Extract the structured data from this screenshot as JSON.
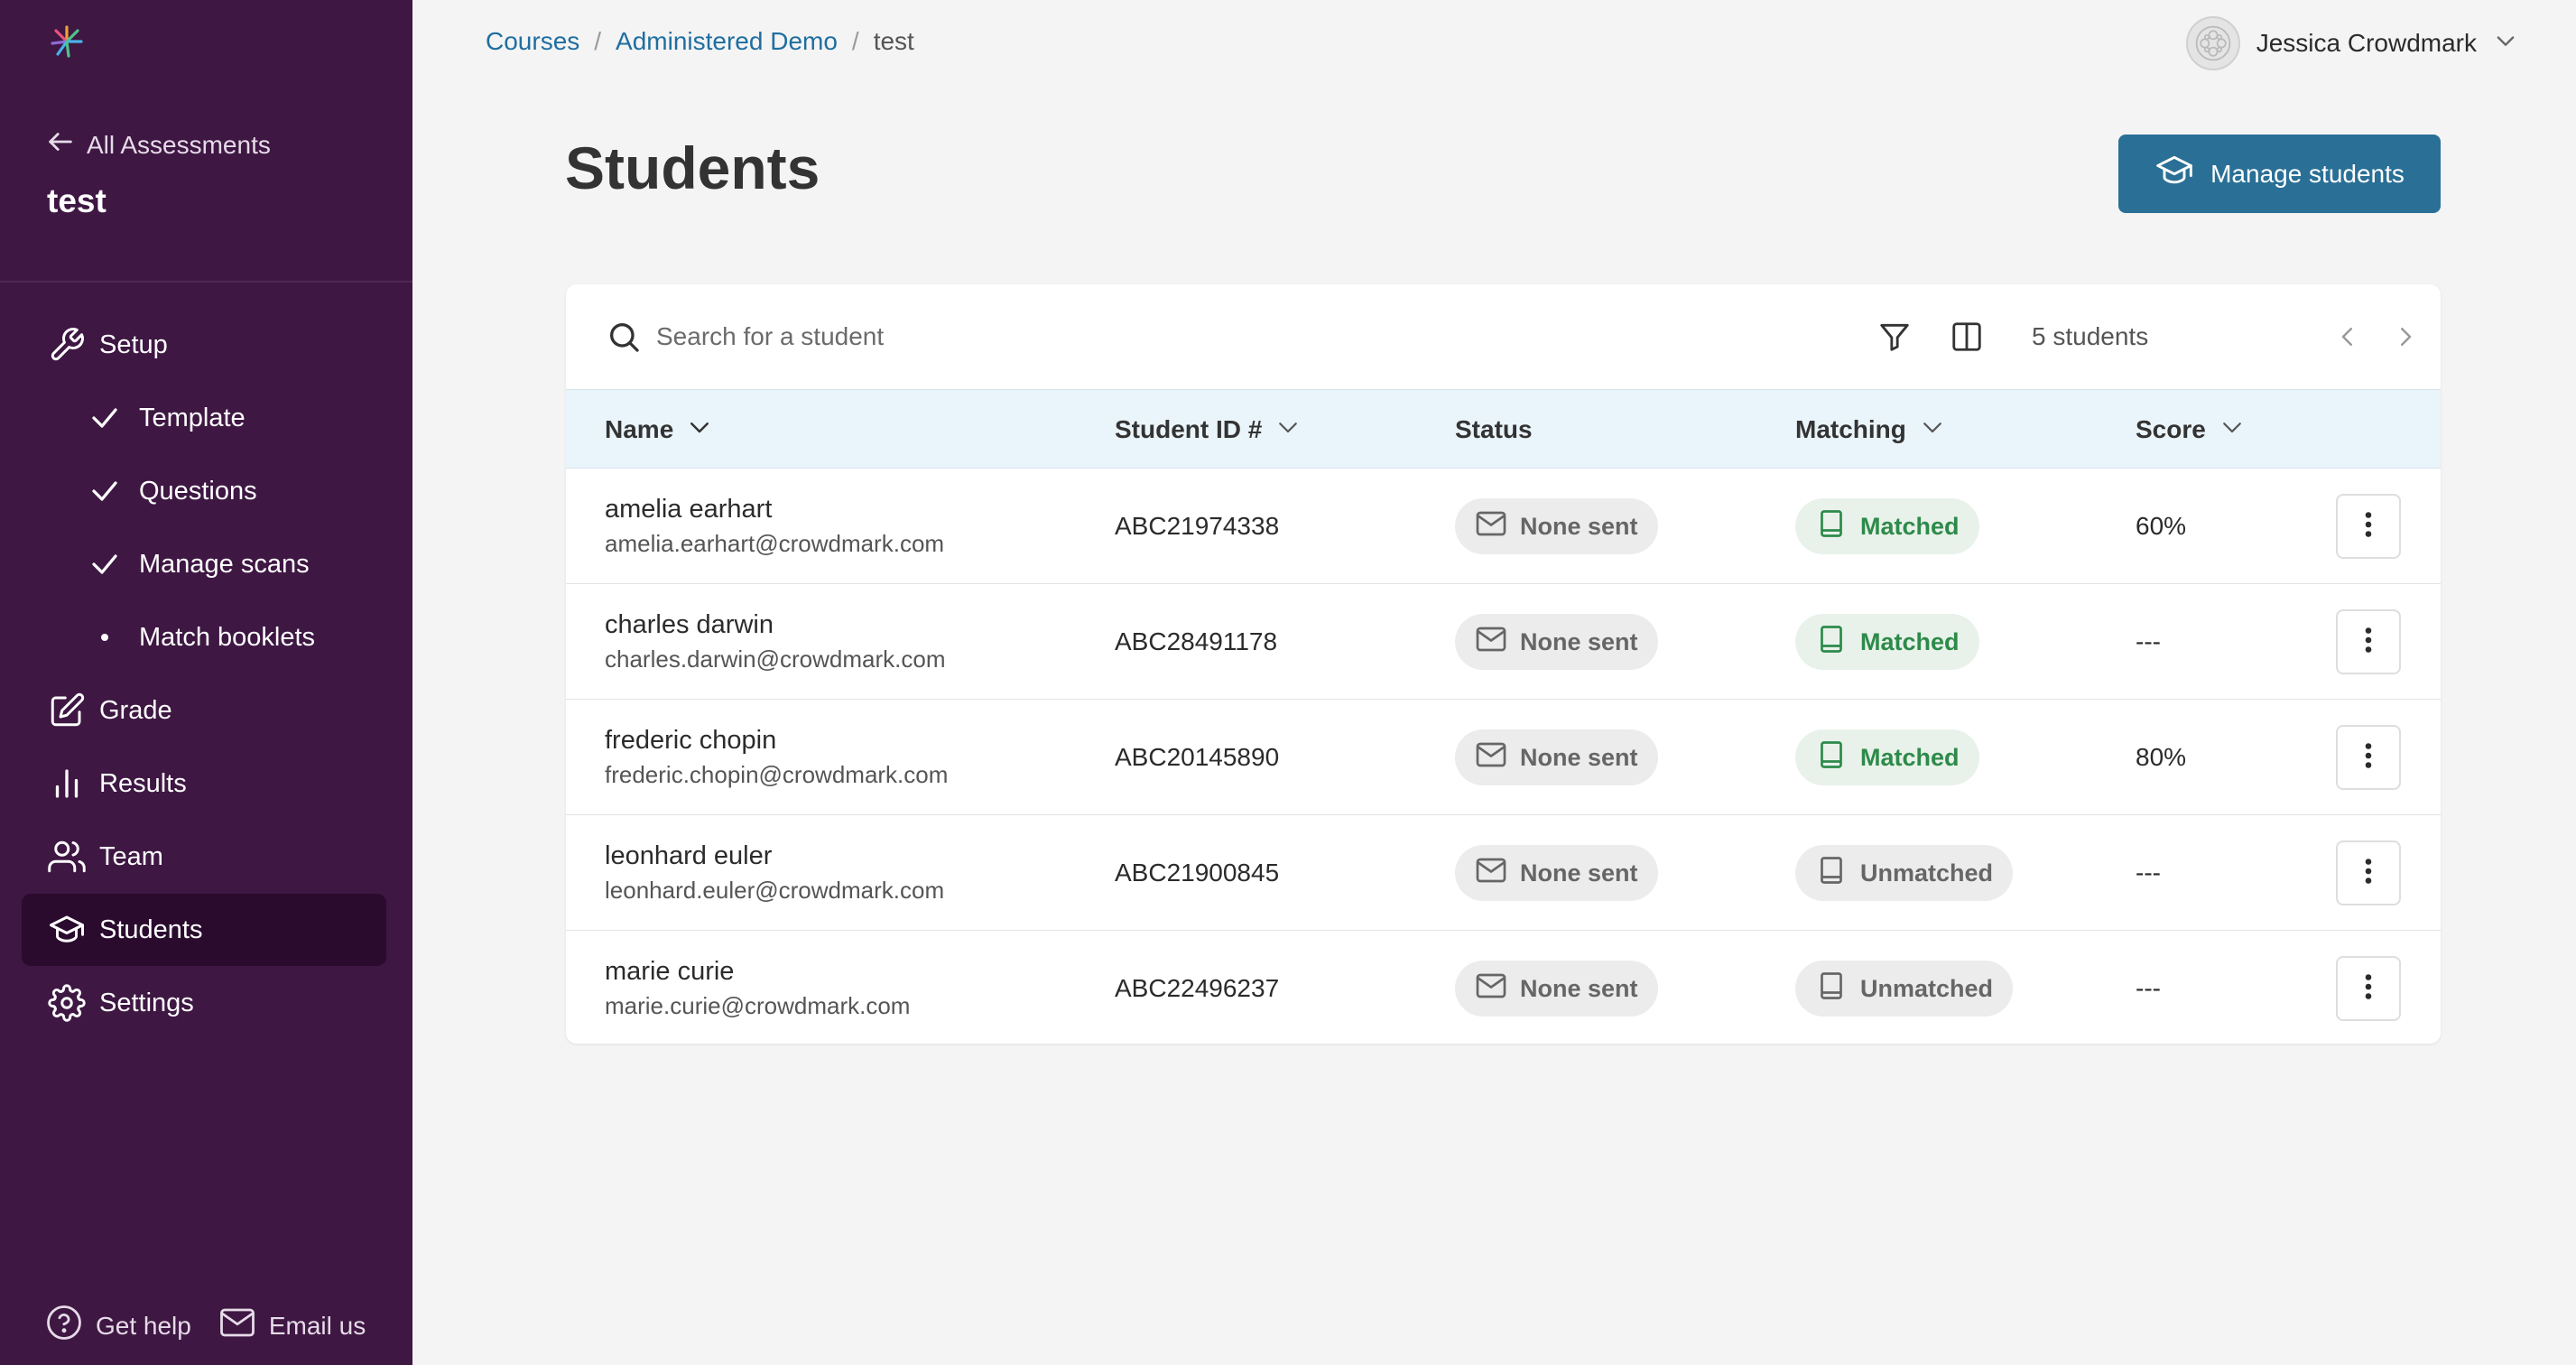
{
  "sidebar": {
    "back_label": "All Assessments",
    "assessment_title": "test",
    "items": [
      {
        "label": "Setup",
        "icon": "wrench-icon"
      },
      {
        "label": "Template",
        "icon": "check-icon"
      },
      {
        "label": "Questions",
        "icon": "check-icon"
      },
      {
        "label": "Manage scans",
        "icon": "check-icon"
      },
      {
        "label": "Match booklets",
        "icon": "bullet-icon"
      },
      {
        "label": "Grade",
        "icon": "pencil-square-icon"
      },
      {
        "label": "Results",
        "icon": "bar-chart-icon"
      },
      {
        "label": "Team",
        "icon": "users-icon"
      },
      {
        "label": "Students",
        "icon": "graduation-cap-icon",
        "active": true
      },
      {
        "label": "Settings",
        "icon": "gear-icon"
      }
    ],
    "footer": {
      "help_label": "Get help",
      "email_label": "Email us"
    }
  },
  "breadcrumb": {
    "courses": "Courses",
    "course": "Administered Demo",
    "current": "test",
    "separator": "/"
  },
  "user": {
    "name": "Jessica Crowdmark"
  },
  "header": {
    "title": "Students",
    "manage_button": "Manage students"
  },
  "toolbar": {
    "search_placeholder": "Search for a student",
    "count": "5 students"
  },
  "table": {
    "columns": {
      "name": "Name",
      "student_id": "Student ID #",
      "status": "Status",
      "matching": "Matching",
      "score": "Score"
    },
    "rows": [
      {
        "name": "amelia earhart",
        "email": "amelia.earhart@crowdmark.com",
        "student_id": "ABC21974338",
        "status": "None sent",
        "matching": "Matched",
        "score": "60%"
      },
      {
        "name": "charles darwin",
        "email": "charles.darwin@crowdmark.com",
        "student_id": "ABC28491178",
        "status": "None sent",
        "matching": "Matched",
        "score": "---"
      },
      {
        "name": "frederic chopin",
        "email": "frederic.chopin@crowdmark.com",
        "student_id": "ABC20145890",
        "status": "None sent",
        "matching": "Matched",
        "score": "80%"
      },
      {
        "name": "leonhard euler",
        "email": "leonhard.euler@crowdmark.com",
        "student_id": "ABC21900845",
        "status": "None sent",
        "matching": "Unmatched",
        "score": "---"
      },
      {
        "name": "marie curie",
        "email": "marie.curie@crowdmark.com",
        "student_id": "ABC22496237",
        "status": "None sent",
        "matching": "Unmatched",
        "score": "---"
      }
    ]
  },
  "colors": {
    "sidebar_bg": "#3e1743",
    "sidebar_active": "#2a0b2e",
    "primary_button": "#2a6f96",
    "link": "#1f6ea0",
    "matched": "#2d8a4a",
    "table_header_bg": "#eaf4fb"
  }
}
